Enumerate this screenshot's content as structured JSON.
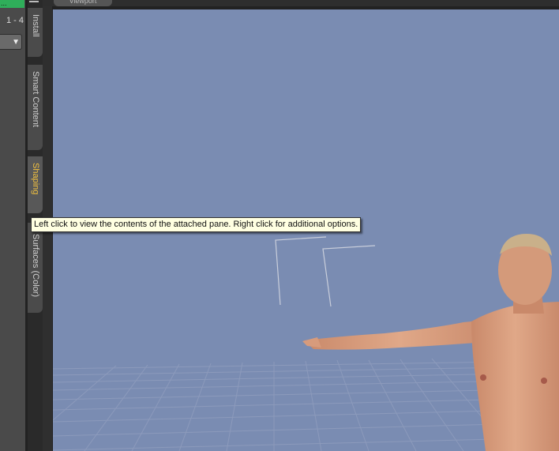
{
  "left_panel": {
    "green_tab": "...",
    "page_range": "1 - 4",
    "dropdown_arrow": "▼"
  },
  "side_tabs": [
    {
      "label": "Install",
      "active": false
    },
    {
      "label": "Smart Content",
      "active": false
    },
    {
      "label": "Shaping",
      "active": true
    },
    {
      "label": "Surfaces (Color)",
      "active": false
    }
  ],
  "viewport": {
    "tab_label": "Viewport",
    "background": "#7a8cb2"
  },
  "tooltip": {
    "text": "Left click to view the contents of the attached pane. Right click for additional options."
  },
  "colors": {
    "accent_active_tab": "#f0c040",
    "green_tab": "#2fae5a"
  }
}
